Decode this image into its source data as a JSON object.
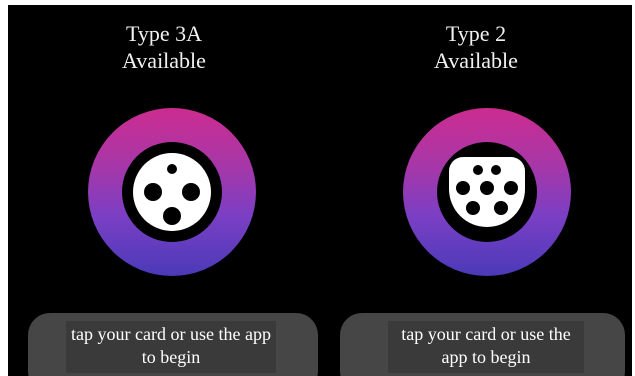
{
  "connectors": [
    {
      "type": "Type 3A",
      "status": "Available",
      "icon": "type-3a-socket-icon",
      "prompt": "tap your card or use the app to begin"
    },
    {
      "type": "Type 2",
      "status": "Available",
      "icon": "type-2-socket-icon",
      "prompt": "tap your card or use the app to begin"
    }
  ],
  "colors": {
    "background": "#000000",
    "ring_top": "#cc2c8f",
    "ring_bottom": "#4a3ab8",
    "status_box": "#464646",
    "text": "#ffffff"
  }
}
